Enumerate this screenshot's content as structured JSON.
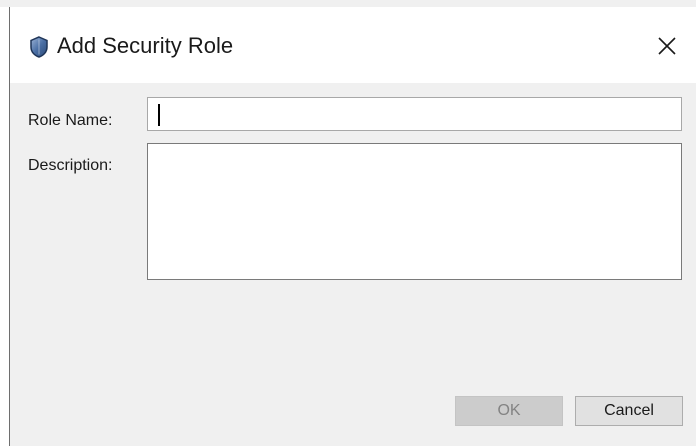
{
  "dialog": {
    "title": "Add Security Role",
    "icon": "shield-icon",
    "close_icon": "close-icon"
  },
  "form": {
    "role_name_label": "Role Name:",
    "role_name_value": "",
    "description_label": "Description:",
    "description_value": ""
  },
  "buttons": {
    "ok_label": "OK",
    "ok_enabled": false,
    "cancel_label": "Cancel"
  },
  "colors": {
    "dialog_body": "#f0f0f0",
    "titlebar": "#ffffff",
    "disabled_button": "#cccccc",
    "button": "#e1e1e1",
    "icon_blue": "#4a6fa5"
  }
}
